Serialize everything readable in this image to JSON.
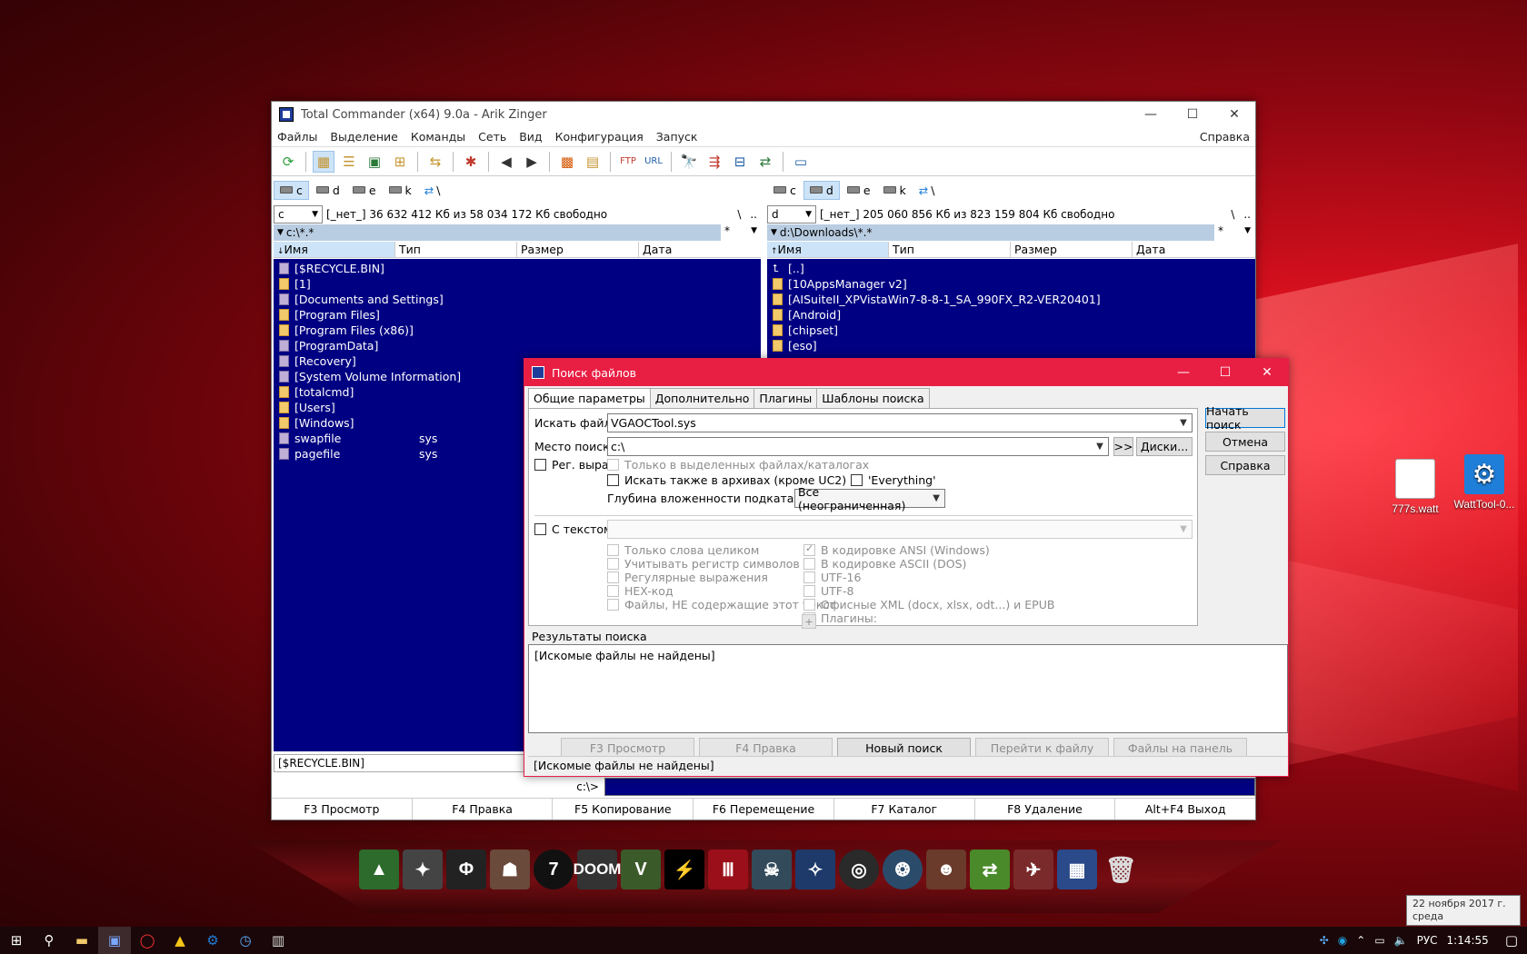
{
  "desktop": {
    "icons": [
      {
        "label": "777s.watt"
      },
      {
        "label": "WattTool-0..."
      }
    ]
  },
  "tc": {
    "title": "Total Commander (x64) 9.0a - Arik Zinger",
    "menu": [
      "Файлы",
      "Выделение",
      "Команды",
      "Сеть",
      "Вид",
      "Конфигурация",
      "Запуск"
    ],
    "help": "Справка",
    "drives_left": [
      "c",
      "d",
      "e",
      "k",
      "\\"
    ],
    "drives_right": [
      "c",
      "d",
      "e",
      "k",
      "\\"
    ],
    "left": {
      "drive": "c",
      "free": "[_нет_]  36 632 412 Кб из 58 034 172 Кб свободно",
      "path": "c:\\*.*",
      "filter": "*",
      "root_btn": "\\",
      "up_btn": "..",
      "cols": [
        "Имя",
        "Тип",
        "Размер",
        "Дата"
      ],
      "files": [
        {
          "name": "[$RECYCLE.BIN]",
          "type": "",
          "sys": true
        },
        {
          "name": "[1]",
          "type": "",
          "sys": false
        },
        {
          "name": "[Documents and Settings]",
          "type": "",
          "sys": true
        },
        {
          "name": "[Program Files]",
          "type": "",
          "sys": false
        },
        {
          "name": "[Program Files (x86)]",
          "type": "",
          "sys": false
        },
        {
          "name": "[ProgramData]",
          "type": "",
          "sys": true
        },
        {
          "name": "[Recovery]",
          "type": "",
          "sys": true
        },
        {
          "name": "[System Volume Information]",
          "type": "",
          "sys": true
        },
        {
          "name": "[totalcmd]",
          "type": "",
          "sys": false
        },
        {
          "name": "[Users]",
          "type": "",
          "sys": false
        },
        {
          "name": "[Windows]",
          "type": "",
          "sys": false
        },
        {
          "name": "swapfile",
          "type": "sys",
          "sys": true
        },
        {
          "name": "pagefile",
          "type": "sys",
          "sys": true
        }
      ],
      "status": "[$RECYCLE.BIN]"
    },
    "right": {
      "drive": "d",
      "free": "[_нет_]  205 060 856 Кб из 823 159 804 Кб свободно",
      "path": "d:\\Downloads\\*.*",
      "filter": "*",
      "root_btn": "\\",
      "up_btn": "..",
      "cols": [
        "Имя",
        "Тип",
        "Размер",
        "Дата"
      ],
      "files": [
        {
          "name": "[..]",
          "up": true
        },
        {
          "name": "[10AppsManager v2]"
        },
        {
          "name": "[AISuiteII_XPVistaWin7-8-8-1_SA_990FX_R2-VER20401]"
        },
        {
          "name": "[Android]"
        },
        {
          "name": "[chipset]"
        },
        {
          "name": "[eso]"
        }
      ]
    },
    "cmd_prompt": "c:\\>",
    "fkeys": [
      "F3 Просмотр",
      "F4 Правка",
      "F5 Копирование",
      "F6 Перемещение",
      "F7 Каталог",
      "F8 Удаление",
      "Alt+F4 Выход"
    ]
  },
  "dialog": {
    "title": "Поиск файлов",
    "tabs": [
      "Общие параметры",
      "Дополнительно",
      "Плагины",
      "Шаблоны поиска"
    ],
    "search_for_label": "Искать файлы:",
    "search_for_value": "VGAOCTool.sys",
    "search_in_label": "Место поиска:",
    "search_in_value": "c:\\",
    "arrows_btn": ">>",
    "drives_btn": "Диски...",
    "regex_label": "Рег. выраж.",
    "only_selected": "Только в выделенных файлах/каталогах",
    "search_archives": "Искать также в архивах (кроме UC2)",
    "everything": "'Everything'",
    "depth_label": "Глубина вложенности подкаталогов:",
    "depth_value": "Все (неограниченная)",
    "with_text_label": "С текстом:",
    "text_opts_left": [
      "Только слова целиком",
      "Учитывать регистр символов",
      "Регулярные выражения",
      "HEX-код",
      "Файлы, НЕ содержащие этот текст"
    ],
    "text_opts_right": [
      "В кодировке ANSI (Windows)",
      "В кодировке ASCII (DOS)",
      "UTF-16",
      "UTF-8",
      "Офисные XML (docx, xlsx, odt...) и EPUB",
      "Плагины:"
    ],
    "plus_btn": "+",
    "btn_start": "Начать поиск",
    "btn_cancel": "Отмена",
    "btn_help": "Справка",
    "results_label": "Результаты поиска",
    "results_text": "[Искомые файлы не найдены]",
    "bottom_buttons": [
      "F3 Просмотр",
      "F4 Правка",
      "Новый поиск",
      "Перейти к файлу",
      "Файлы на панель"
    ],
    "status": "[Искомые файлы не найдены]"
  },
  "taskbar": {
    "lang": "РУС",
    "time": "1:14:55",
    "tooltip_date": "22 ноября 2017 г.",
    "tooltip_day": "среда"
  },
  "dock": {
    "labels": [
      "DOOM",
      "7",
      "V"
    ]
  }
}
